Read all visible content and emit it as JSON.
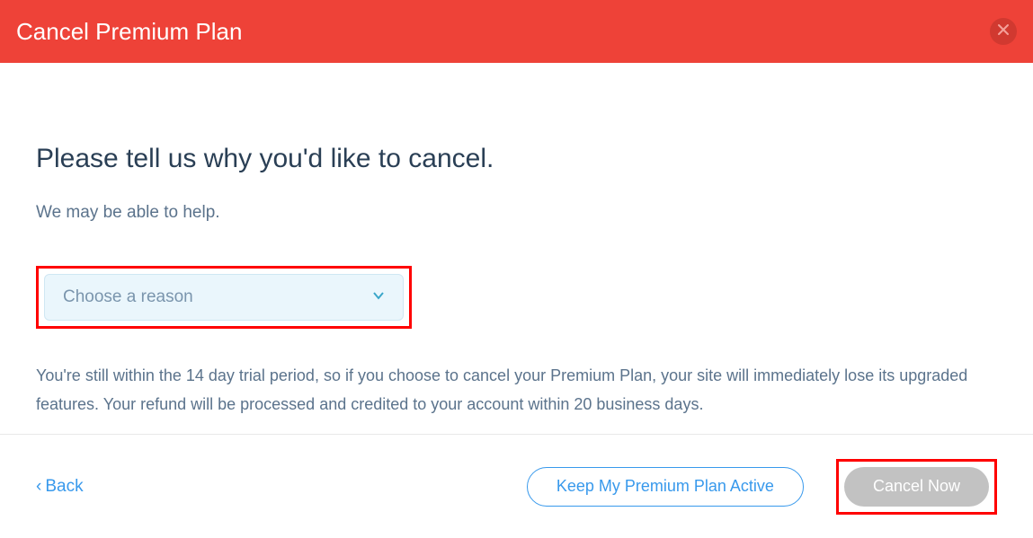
{
  "header": {
    "title": "Cancel Premium Plan"
  },
  "content": {
    "heading": "Please tell us why you'd like to cancel.",
    "subtext": "We may be able to help.",
    "reason_placeholder": "Choose a reason",
    "trial_notice": "You're still within the 14 day trial period, so if you choose to cancel your Premium Plan, your site will immediately lose its upgraded features. Your refund will be processed and credited to your account within 20 business days."
  },
  "footer": {
    "back_label": "Back",
    "keep_active_label": "Keep My Premium Plan Active",
    "cancel_now_label": "Cancel Now"
  }
}
